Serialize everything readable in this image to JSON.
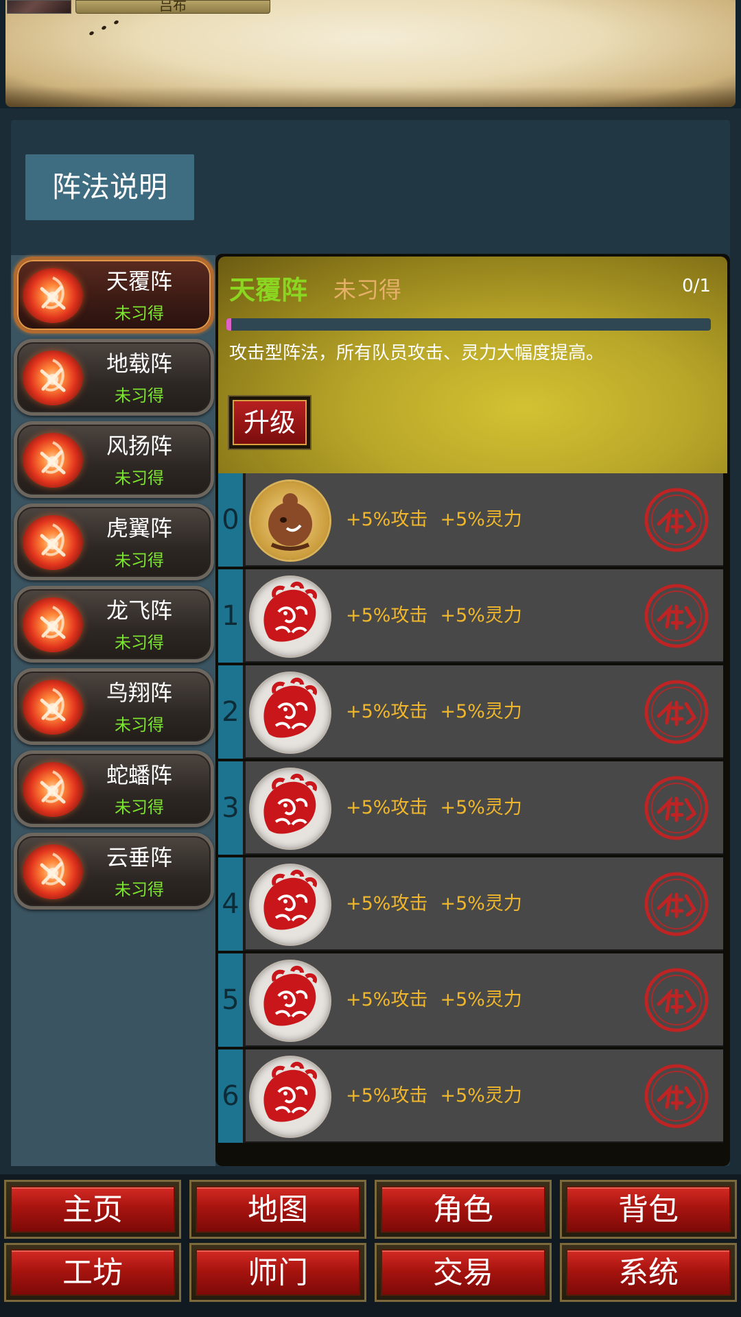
{
  "header": {
    "character_name": "吕布"
  },
  "explain_button": "阵法说明",
  "formations": [
    {
      "name": "天覆阵",
      "status": "未习得",
      "selected": true
    },
    {
      "name": "地载阵",
      "status": "未习得",
      "selected": false
    },
    {
      "name": "风扬阵",
      "status": "未习得",
      "selected": false
    },
    {
      "name": "虎翼阵",
      "status": "未习得",
      "selected": false
    },
    {
      "name": "龙飞阵",
      "status": "未习得",
      "selected": false
    },
    {
      "name": "鸟翔阵",
      "status": "未习得",
      "selected": false
    },
    {
      "name": "蛇蟠阵",
      "status": "未习得",
      "selected": false
    },
    {
      "name": "云垂阵",
      "status": "未习得",
      "selected": false
    }
  ],
  "detail": {
    "title": "天覆阵",
    "learned_status": "未习得",
    "progress_text": "0/1",
    "progress_fraction": 0.01,
    "description": "攻击型阵法，所有队员攻击、灵力大幅度提高。",
    "upgrade_label": "升级"
  },
  "levels": [
    {
      "index": "0",
      "effect_attack": "+5%攻击",
      "effect_spirit": "+5%灵力",
      "avatar": "pet-doll-icon"
    },
    {
      "index": "1",
      "effect_attack": "+5%攻击",
      "effect_spirit": "+5%灵力",
      "avatar": "red-beast-icon"
    },
    {
      "index": "2",
      "effect_attack": "+5%攻击",
      "effect_spirit": "+5%灵力",
      "avatar": "red-beast-icon"
    },
    {
      "index": "3",
      "effect_attack": "+5%攻击",
      "effect_spirit": "+5%灵力",
      "avatar": "red-beast-icon"
    },
    {
      "index": "4",
      "effect_attack": "+5%攻击",
      "effect_spirit": "+5%灵力",
      "avatar": "red-beast-icon"
    },
    {
      "index": "5",
      "effect_attack": "+5%攻击",
      "effect_spirit": "+5%灵力",
      "avatar": "red-beast-icon"
    },
    {
      "index": "6",
      "effect_attack": "+5%攻击",
      "effect_spirit": "+5%灵力",
      "avatar": "red-beast-icon"
    }
  ],
  "nav": {
    "home": "主页",
    "map": "地图",
    "character": "角色",
    "bag": "背包",
    "workshop": "工坊",
    "sect": "师门",
    "trade": "交易",
    "system": "系统"
  },
  "colors": {
    "learned_status": "#7be62e",
    "detail_title": "#8ad621",
    "effect_text": "#f0b72c",
    "level_index_bar": "#1c7490",
    "nav_button_red": "#a8140f"
  }
}
